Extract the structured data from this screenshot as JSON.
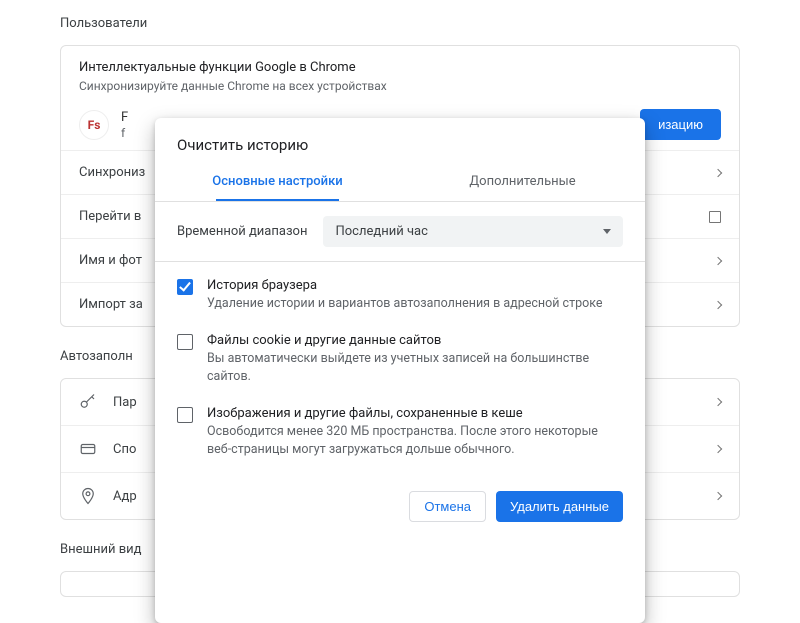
{
  "sections": {
    "users_title": "Пользователи",
    "intro_title": "Интеллектуальные функции Google в Chrome",
    "intro_sub": "Синхронизируйте данные Chrome на всех устройствах",
    "profile": {
      "avatar_text": "Fs",
      "name_fragment": "F",
      "email_fragment": "f"
    },
    "sync_button_fragment": "изацию",
    "row_sync": "Синхрониз",
    "row_goto": "Перейти в",
    "row_name": "Имя и фот",
    "row_import": "Импорт за",
    "autofill_title": "Автозаполн",
    "row_pw": "Пар",
    "row_pay": "Спо",
    "row_addr": "Адр",
    "appearance_title": "Внешний вид"
  },
  "dialog": {
    "title": "Очистить историю",
    "tabs": {
      "basic": "Основные настройки",
      "advanced": "Дополнительные"
    },
    "time_range_label": "Временной диапазон",
    "time_range_value": "Последний час",
    "options": [
      {
        "checked": true,
        "title": "История браузера",
        "desc": "Удаление истории и вариантов автозаполнения в адресной строке"
      },
      {
        "checked": false,
        "title": "Файлы cookie и другие данные сайтов",
        "desc": "Вы автоматически выйдете из учетных записей на большинстве сайтов."
      },
      {
        "checked": false,
        "title": "Изображения и другие файлы, сохраненные в кеше",
        "desc": "Освободится менее 320 МБ пространства. После этого некоторые веб-страницы могут загружаться дольше обычного."
      }
    ],
    "cancel": "Отмена",
    "confirm": "Удалить данные"
  }
}
